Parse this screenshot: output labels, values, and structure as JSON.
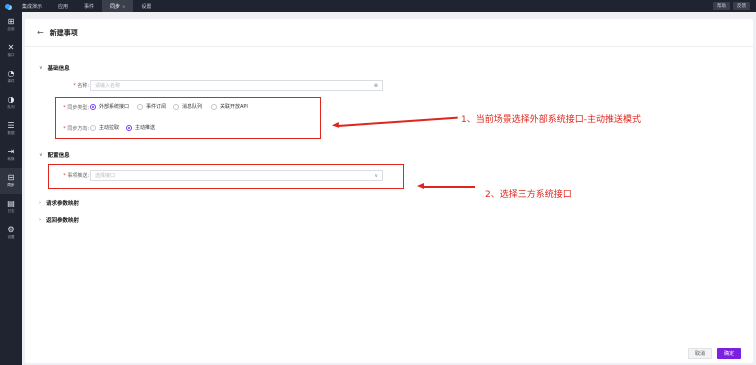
{
  "topbar": {
    "tabs": [
      {
        "label": "集成演示"
      },
      {
        "label": "应用"
      },
      {
        "label": "事件"
      },
      {
        "label": "同步",
        "close": "×"
      },
      {
        "label": "设置"
      }
    ],
    "right_buttons": [
      "帮助",
      "反馈"
    ]
  },
  "leftnav": [
    {
      "icon": "⊞",
      "label": "应用"
    },
    {
      "icon": "✕",
      "label": "接口"
    },
    {
      "icon": "◔",
      "label": "事件"
    },
    {
      "icon": "◑",
      "label": "队列"
    },
    {
      "icon": "☰",
      "label": "数据"
    },
    {
      "icon": "⇥",
      "label": "转换"
    },
    {
      "icon": "⊟",
      "label": "同步"
    },
    {
      "icon": "▤",
      "label": "日志"
    },
    {
      "icon": "⚙",
      "label": "设置"
    }
  ],
  "page": {
    "back": "←",
    "title": "新建事项"
  },
  "basic": {
    "section_title": "基础信息",
    "name_label": "名称:",
    "name_placeholder": "请输入名称",
    "name_trail": "⊗",
    "sync_type_label": "同步类型:",
    "sync_types": [
      "外部系统接口",
      "事件订阅",
      "消息队列",
      "关联开放API"
    ],
    "sync_dir_label": "同步方向:",
    "sync_dirs": [
      "主动拉取",
      "主动推送"
    ]
  },
  "config": {
    "section_title": "配置信息",
    "event_label": "事项推送:",
    "event_placeholder": "选择接口",
    "event_trail": "∨"
  },
  "collapsed": [
    "请求参数映射",
    "返回参数映射"
  ],
  "annotations": {
    "first": "1、当前场景选择外部系统接口-主动推送模式",
    "second": "2、选择三方系统接口"
  },
  "footer": {
    "cancel": "取消",
    "ok": "确定"
  },
  "colors": {
    "accent": "#7b1fe0",
    "annotation": "#e0261c"
  }
}
